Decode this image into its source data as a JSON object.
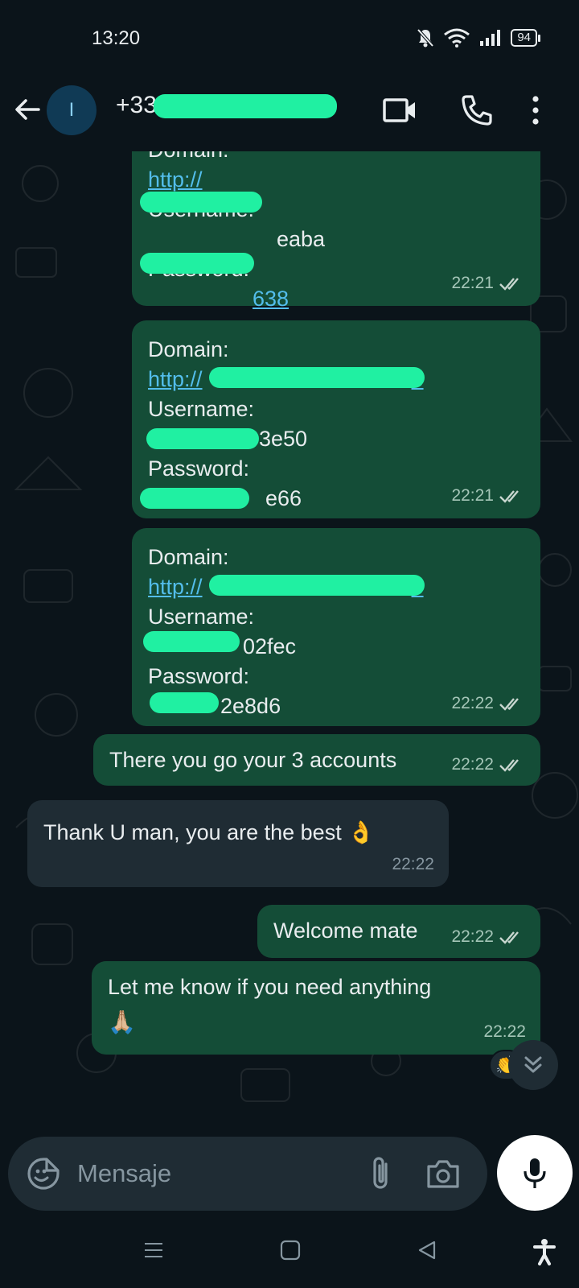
{
  "status_bar": {
    "time": "13:20",
    "battery": "94",
    "icons": [
      "mute-icon",
      "wifi-icon",
      "signal-icon",
      "battery-icon"
    ]
  },
  "header": {
    "avatar_initial": "I",
    "contact_prefix": "+33",
    "icons": [
      "back-icon",
      "video-call-icon",
      "voice-call-icon",
      "more-options-icon"
    ]
  },
  "messages": [
    {
      "direction": "outgoing",
      "lines": [
        {
          "text": "Domain:"
        },
        {
          "text": "http://",
          "link": true
        },
        {
          "text": "Username:"
        },
        {
          "text": "eaba"
        },
        {
          "text": "Password:"
        },
        {
          "text": "638",
          "link": true
        }
      ],
      "time": "22:21"
    },
    {
      "direction": "outgoing",
      "lines": [
        {
          "text": "Domain:"
        },
        {
          "text": "http://",
          "link": true,
          "suffix": "e"
        },
        {
          "text": "Username:"
        },
        {
          "text": "3e50"
        },
        {
          "text": "Password:"
        },
        {
          "text": "e66"
        }
      ],
      "time": "22:21"
    },
    {
      "direction": "outgoing",
      "lines": [
        {
          "text": "Domain:"
        },
        {
          "text": "http://",
          "link": true,
          "suffix": "e"
        },
        {
          "text": "Username:"
        },
        {
          "text": "02fec"
        },
        {
          "text": "Password:"
        },
        {
          "text": "2e8d6"
        }
      ],
      "time": "22:22"
    },
    {
      "direction": "outgoing",
      "text": "There you go your 3 accounts",
      "time": "22:22"
    },
    {
      "direction": "incoming",
      "text": "Thank U man, you are the best 👌",
      "time": "22:22"
    },
    {
      "direction": "outgoing",
      "text": "Welcome mate",
      "time": "22:22"
    },
    {
      "direction": "outgoing",
      "text": "Let me know if you need anything",
      "emoji": "🙏🏼",
      "time": "22:22"
    }
  ],
  "reaction": "👏",
  "composer": {
    "placeholder": "Mensaje"
  },
  "colors": {
    "background": "#0b141a",
    "outgoing_bubble": "#144d37",
    "incoming_bubble": "#1f2c34",
    "link": "#53bdeb",
    "redaction": "#20f0a2"
  }
}
